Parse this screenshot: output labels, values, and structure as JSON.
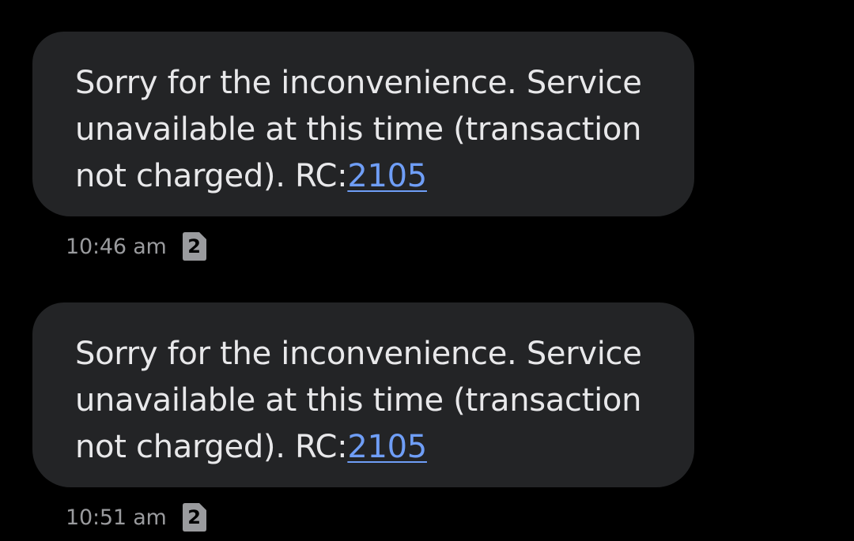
{
  "colors": {
    "background": "#000000",
    "bubble": "#232426",
    "message_text": "#e8e8ea",
    "link": "#6f9ef7",
    "timestamp": "#9a9b9e",
    "sim_badge": "#9a9b9e"
  },
  "messages": [
    {
      "text": "Sorry for the inconvenience. Service unavailable at this time (transaction not charged). RC:",
      "link": "2105",
      "time": "10:46 am",
      "sim_icon": "sim-card-icon",
      "sim_slot": "2"
    },
    {
      "text": "Sorry for the inconvenience. Service unavailable at this time (transaction not charged). RC:",
      "link": "2105",
      "time": "10:51 am",
      "sim_icon": "sim-card-icon",
      "sim_slot": "2"
    }
  ]
}
